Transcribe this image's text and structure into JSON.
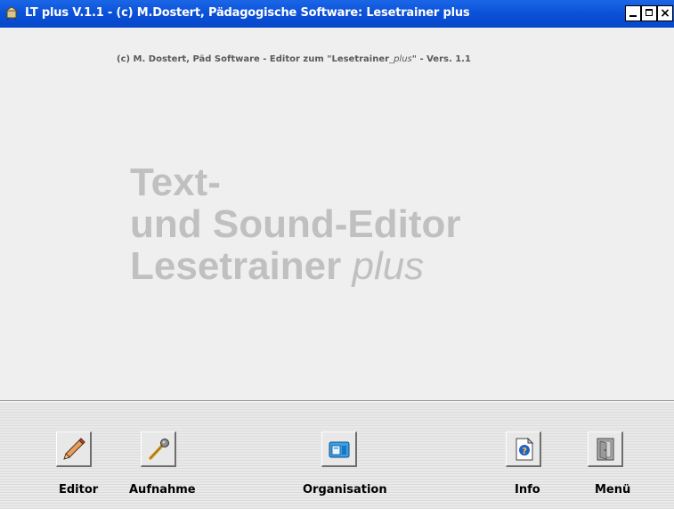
{
  "window": {
    "title": "LT plus  V.1.1 - (c) M.Dostert, Pädagogische Software: Lesetrainer plus",
    "app_icon": "app-icon",
    "controls": {
      "minimize": "minimize-icon",
      "maximize": "maximize-icon",
      "close": "×"
    }
  },
  "main": {
    "subtitle_part1": "(c) M. Dostert,  Päd Software   - Editor zum  \"Lesetrainer",
    "subtitle_plus": "_plus",
    "subtitle_part2": "\" -  Vers. 1.1",
    "headline_line1": "Text-",
    "headline_line2": "und Sound-Editor",
    "headline_line3_a": "Lesetrainer ",
    "headline_line3_b": "plus"
  },
  "toolbar": {
    "editor_label": "Editor",
    "editor_icon": "pencil-icon",
    "aufnahme_label": "Aufnahme",
    "aufnahme_icon": "microphone-icon",
    "organisation_label": "Organisation",
    "organisation_icon": "folder-icon",
    "info_label": "Info",
    "info_icon": "help-document-icon",
    "menu_label": "Menü",
    "menu_icon": "door-icon"
  },
  "colors": {
    "titlebar": "#0a50d8",
    "background": "#efefef",
    "headline": "#c0c0c0"
  }
}
